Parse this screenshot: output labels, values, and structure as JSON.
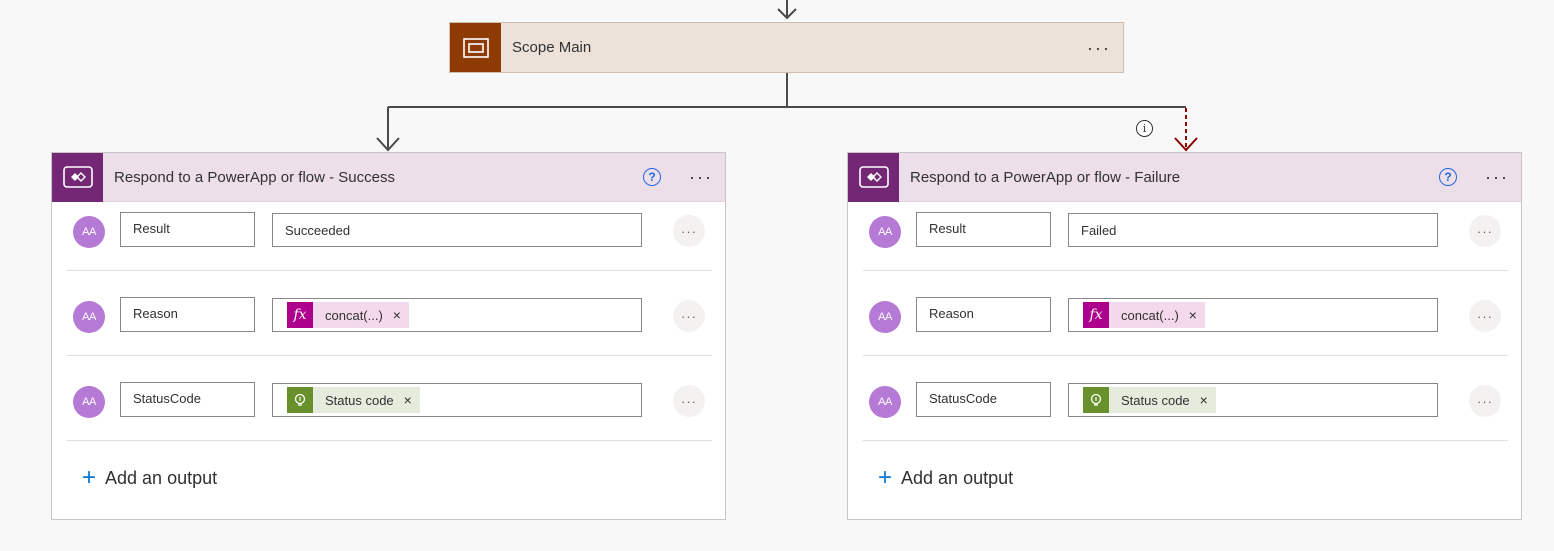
{
  "scope": {
    "title": "Scope Main",
    "menu": "···"
  },
  "cards": [
    {
      "title": "Respond to a PowerApp or flow - Success",
      "help": "?",
      "menu": "···",
      "rows": [
        {
          "avatar": "AA",
          "key": "Result",
          "value": "Succeeded"
        },
        {
          "avatar": "AA",
          "key": "Reason",
          "token": "concat(...)",
          "token_remove": "×"
        },
        {
          "avatar": "AA",
          "key": "StatusCode",
          "token": "Status code",
          "token_remove": "×"
        }
      ],
      "row_menu": "···",
      "add_output": "Add an output",
      "add_plus": "+"
    },
    {
      "title": "Respond to a PowerApp or flow - Failure",
      "help": "?",
      "menu": "···",
      "rows": [
        {
          "avatar": "AA",
          "key": "Result",
          "value": "Failed"
        },
        {
          "avatar": "AA",
          "key": "Reason",
          "token": "concat(...)",
          "token_remove": "×"
        },
        {
          "avatar": "AA",
          "key": "StatusCode",
          "token": "Status code",
          "token_remove": "×"
        }
      ],
      "row_menu": "···",
      "add_output": "Add an output",
      "add_plus": "+"
    }
  ],
  "info_icon": "i",
  "colors": {
    "scope_accent": "#8e3a05",
    "powerapps_accent": "#742774",
    "fx_token": "#ad008c",
    "status_token": "#68902b",
    "failure_arrow": "#8b0000",
    "link_blue": "#0078d4"
  }
}
